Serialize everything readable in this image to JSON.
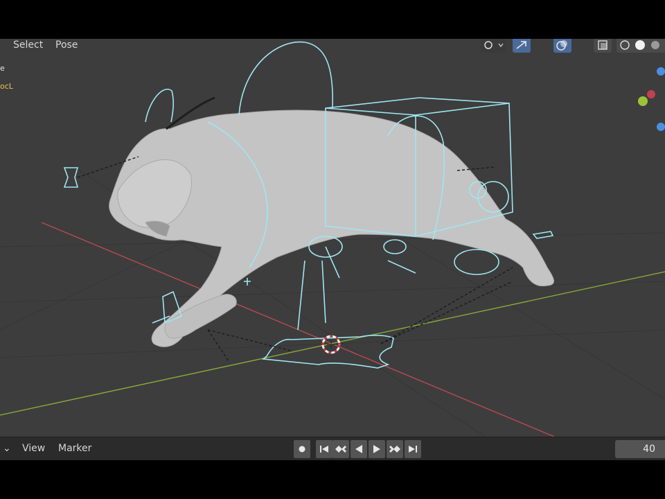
{
  "header": {
    "menus": {
      "select": "Select",
      "pose": "Pose"
    },
    "object_info": {
      "line1": "e",
      "line2": "ocL"
    }
  },
  "timeline": {
    "menus": {
      "dropdown": "⌄",
      "view": "View",
      "marker": "Marker"
    },
    "current_frame": "40"
  },
  "colors": {
    "viewport_bg": "#3d3d3d",
    "x_axis": "#b84a52",
    "y_axis": "#8aa83a",
    "bone_selected": "#9fe6f2",
    "mesh": "#c4c4c4",
    "accent_blue": "#4a6a9a"
  },
  "icons": {
    "record": "record-icon",
    "jump_start": "jump-to-start-icon",
    "prev_keyframe": "prev-keyframe-icon",
    "play_reverse": "play-reverse-icon",
    "play": "play-icon",
    "next_keyframe": "next-keyframe-icon",
    "jump_end": "jump-to-end-icon"
  }
}
